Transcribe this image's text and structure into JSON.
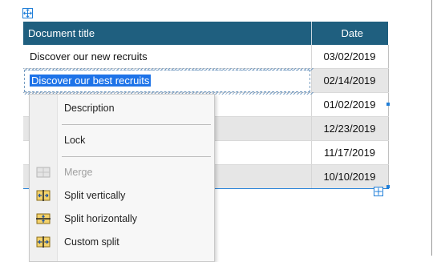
{
  "table": {
    "headers": [
      "Document title",
      "Date"
    ],
    "rows": [
      {
        "title": "Discover our new recruits",
        "date": "03/02/2019"
      },
      {
        "title": "Discover our best recruits",
        "date": "02/14/2019"
      },
      {
        "title": "",
        "date": "01/02/2019"
      },
      {
        "title": "",
        "date": "12/23/2019"
      },
      {
        "title": "",
        "date": "11/17/2019"
      },
      {
        "title": "",
        "date": "10/10/2019"
      }
    ]
  },
  "context_menu": {
    "items": [
      {
        "label": "Description",
        "icon": "none",
        "enabled": true
      },
      {
        "label": "Lock",
        "icon": "none",
        "enabled": true
      },
      {
        "label": "Merge",
        "icon": "merge-cells-icon",
        "enabled": false
      },
      {
        "label": "Split vertically",
        "icon": "split-vertical-icon",
        "enabled": true
      },
      {
        "label": "Split horizontally",
        "icon": "split-horizontal-icon",
        "enabled": true
      },
      {
        "label": "Custom split",
        "icon": "custom-split-icon",
        "enabled": true
      }
    ]
  },
  "colors": {
    "header_bg": "#1f5f7f",
    "selection": "#1e73e8",
    "handle": "#1f7ed8"
  }
}
